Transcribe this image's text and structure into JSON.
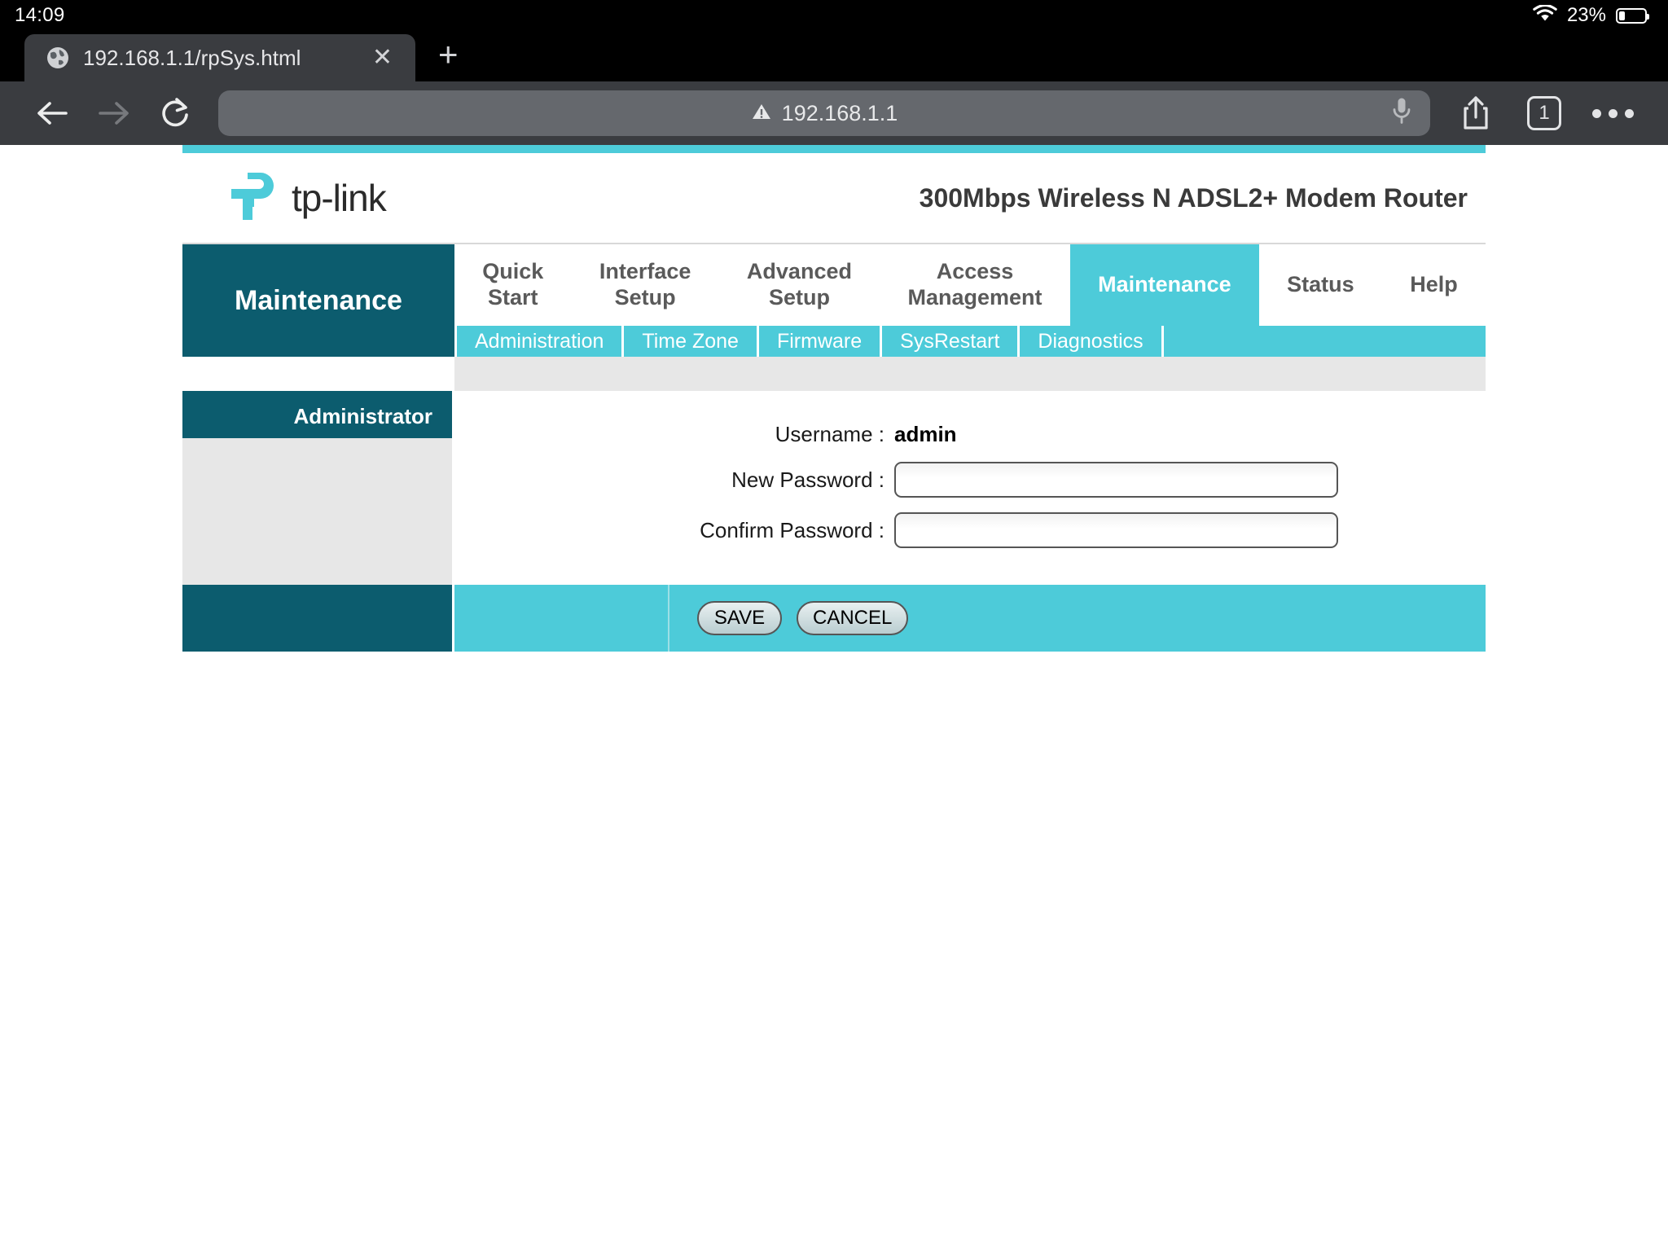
{
  "status_bar": {
    "time": "14:09",
    "battery_percent": "23%",
    "wifi_icon": "wifi-icon",
    "battery_icon": "battery-icon"
  },
  "browser": {
    "tab": {
      "title": "192.168.1.1/rpSys.html",
      "favicon": "globe-icon",
      "close_label": "✕"
    },
    "new_tab_label": "+",
    "back_icon": "back-arrow-icon",
    "forward_icon": "forward-arrow-icon",
    "reload_icon": "reload-icon",
    "url": "192.168.1.1",
    "url_warning_icon": "warning-triangle-icon",
    "mic_icon": "microphone-icon",
    "share_icon": "share-icon",
    "tab_count": "1",
    "more_icon": "more-options-icon"
  },
  "router": {
    "brand": "tp-link",
    "product_name": "300Mbps Wireless N ADSL2+ Modem Router",
    "accent_color": "#4DCBD9",
    "dark_color": "#0C5C6E",
    "sidebar_title": "Maintenance",
    "main_tabs": [
      {
        "line1": "Quick",
        "line2": "Start",
        "active": false
      },
      {
        "line1": "Interface",
        "line2": "Setup",
        "active": false
      },
      {
        "line1": "Advanced",
        "line2": "Setup",
        "active": false
      },
      {
        "line1": "Access",
        "line2": "Management",
        "active": false
      },
      {
        "line1": "Maintenance",
        "line2": "",
        "active": true
      },
      {
        "line1": "Status",
        "line2": "",
        "active": false
      },
      {
        "line1": "Help",
        "line2": "",
        "active": false
      }
    ],
    "sub_tabs": [
      "Administration",
      "Time Zone",
      "Firmware",
      "SysRestart",
      "Diagnostics"
    ],
    "section_label": "Administrator",
    "form": {
      "username_label": "Username :",
      "username_value": "admin",
      "new_password_label": "New Password :",
      "new_password_value": "",
      "confirm_password_label": "Confirm Password :",
      "confirm_password_value": ""
    },
    "buttons": {
      "save": "SAVE",
      "cancel": "CANCEL"
    }
  }
}
